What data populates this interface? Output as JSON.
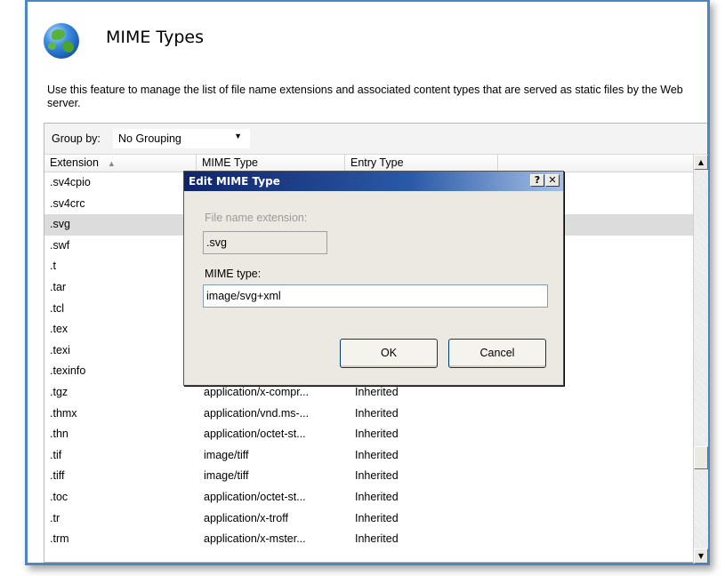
{
  "page": {
    "title": "MIME Types",
    "description": "Use this feature to manage the list of file name extensions and associated content types that are served as static files by the Web server.",
    "icon": "globe-icon"
  },
  "group_bar": {
    "label": "Group by:",
    "selected": "No Grouping"
  },
  "table": {
    "columns": [
      "Extension",
      "MIME Type",
      "Entry Type"
    ],
    "sorted_column": "Extension",
    "rows": [
      {
        "ext": ".sv4cpio",
        "mime": "",
        "entry": ""
      },
      {
        "ext": ".sv4crc",
        "mime": "",
        "entry": ""
      },
      {
        "ext": ".svg",
        "mime": "",
        "entry": "",
        "selected": true
      },
      {
        "ext": ".swf",
        "mime": "",
        "entry": ""
      },
      {
        "ext": ".t",
        "mime": "",
        "entry": ""
      },
      {
        "ext": ".tar",
        "mime": "",
        "entry": ""
      },
      {
        "ext": ".tcl",
        "mime": "",
        "entry": ""
      },
      {
        "ext": ".tex",
        "mime": "",
        "entry": ""
      },
      {
        "ext": ".texi",
        "mime": "",
        "entry": ""
      },
      {
        "ext": ".texinfo",
        "mime": "",
        "entry": ""
      },
      {
        "ext": ".tgz",
        "mime": "application/x-compr...",
        "entry": "Inherited"
      },
      {
        "ext": ".thmx",
        "mime": "application/vnd.ms-...",
        "entry": "Inherited"
      },
      {
        "ext": ".thn",
        "mime": "application/octet-st...",
        "entry": "Inherited"
      },
      {
        "ext": ".tif",
        "mime": "image/tiff",
        "entry": "Inherited"
      },
      {
        "ext": ".tiff",
        "mime": "image/tiff",
        "entry": "Inherited"
      },
      {
        "ext": ".toc",
        "mime": "application/octet-st...",
        "entry": "Inherited"
      },
      {
        "ext": ".tr",
        "mime": "application/x-troff",
        "entry": "Inherited"
      },
      {
        "ext": ".trm",
        "mime": "application/x-mster...",
        "entry": "Inherited"
      }
    ]
  },
  "dialog": {
    "title": "Edit MIME Type",
    "help_button": "?",
    "close_button": "✕",
    "ext_label": "File name extension:",
    "ext_value": ".svg",
    "mime_label": "MIME type:",
    "mime_value": "image/svg+xml",
    "ok_label": "OK",
    "cancel_label": "Cancel"
  },
  "colors": {
    "frame_border": "#4d86c4",
    "dialog_title_start": "#10246a",
    "dialog_title_end": "#a6c1e6",
    "selected_row": "#dcdcdc"
  }
}
